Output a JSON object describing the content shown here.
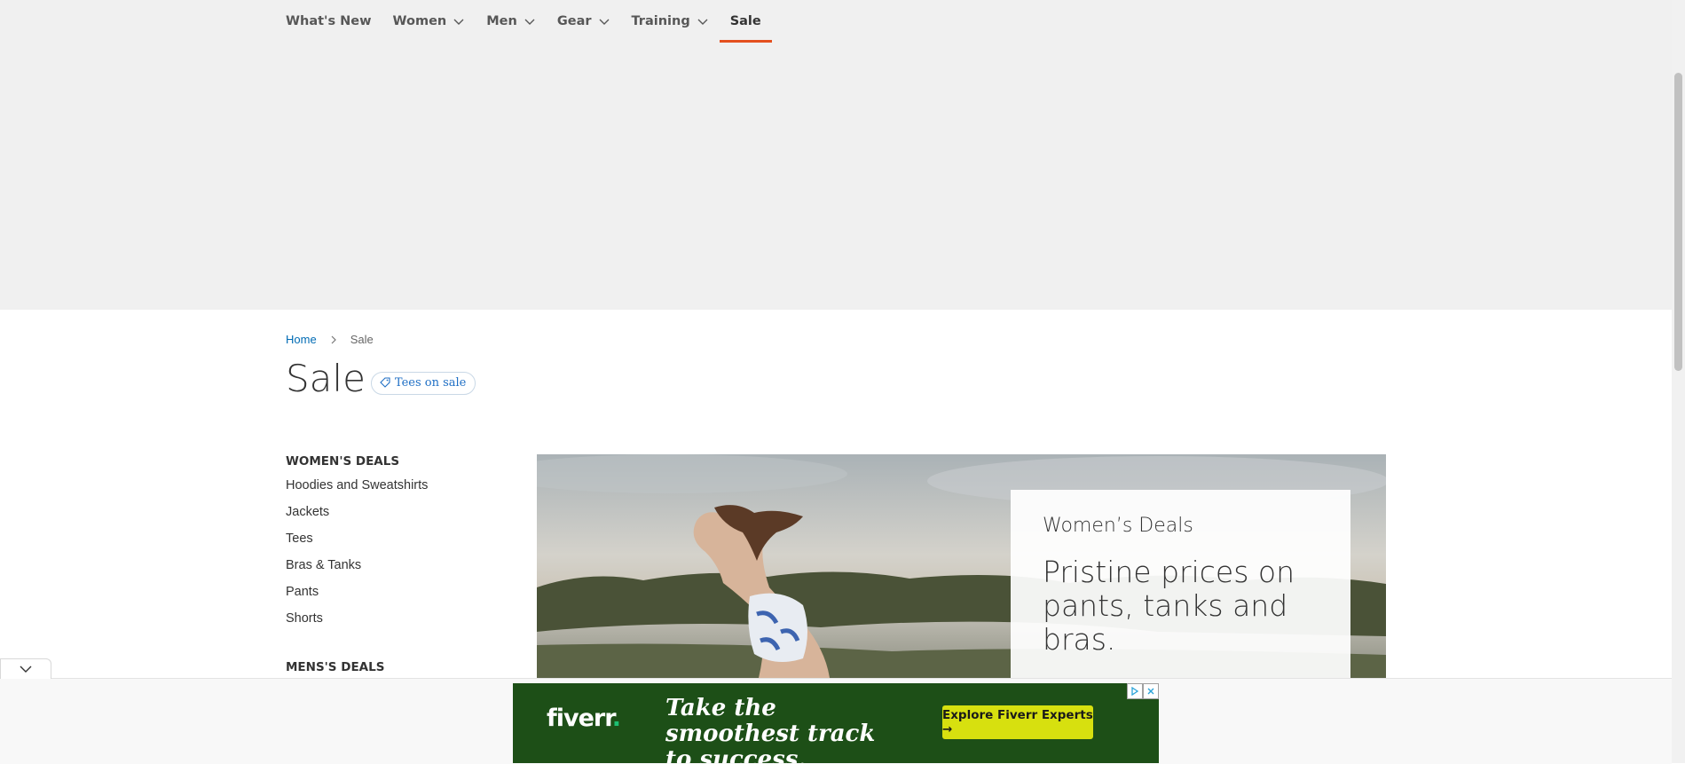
{
  "nav": {
    "items": [
      {
        "label": "What's New",
        "has_dropdown": false
      },
      {
        "label": "Women",
        "has_dropdown": true
      },
      {
        "label": "Men",
        "has_dropdown": true
      },
      {
        "label": "Gear",
        "has_dropdown": true
      },
      {
        "label": "Training",
        "has_dropdown": true
      },
      {
        "label": "Sale",
        "has_dropdown": false,
        "active": true
      }
    ],
    "accent_color": "#e4501f"
  },
  "breadcrumb": {
    "home": "Home",
    "current": "Sale"
  },
  "page": {
    "title": "Sale",
    "tag_label": "Tees on sale"
  },
  "sidebar": {
    "womens_heading": "WOMEN'S DEALS",
    "womens_items": [
      "Hoodies and Sweatshirts",
      "Jackets",
      "Tees",
      "Bras & Tanks",
      "Pants",
      "Shorts"
    ],
    "mens_heading": "MENS'S DEALS"
  },
  "hero": {
    "subtitle": "Women’s Deals",
    "headline": "Pristine prices on pants, tanks and bras."
  },
  "ad": {
    "logo": "fiverr",
    "logo_dot": ".",
    "headline": "Take the smoothest track to success.",
    "cta": "Explore Fiverr Experts →"
  }
}
